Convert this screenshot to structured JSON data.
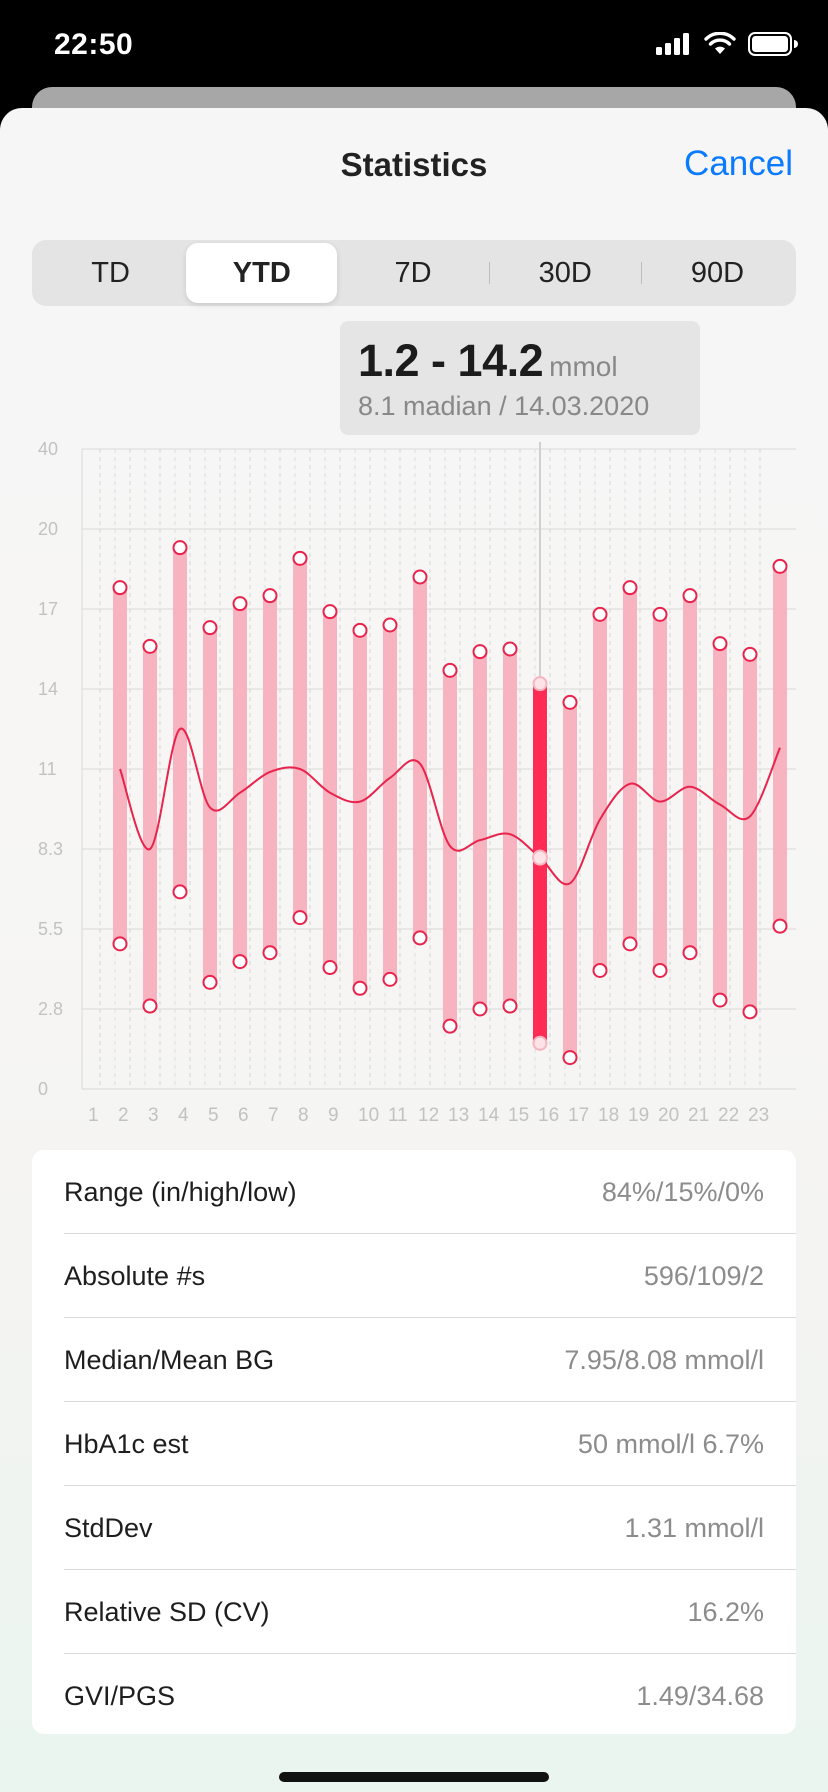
{
  "status": {
    "time": "22:50",
    "signal_icon": "signal-bars-icon",
    "wifi_icon": "wifi-icon",
    "battery_icon": "battery-icon"
  },
  "nav": {
    "title": "Statistics",
    "cancel_label": "Cancel"
  },
  "segments": [
    {
      "label": "TD",
      "selected": false
    },
    {
      "label": "YTD",
      "selected": true
    },
    {
      "label": "7D",
      "selected": false
    },
    {
      "label": "30D",
      "selected": false
    },
    {
      "label": "90D",
      "selected": false
    }
  ],
  "tooltip": {
    "range": "1.2 - 14.2",
    "unit": "mmol",
    "subtitle": "8.1 madian / 14.03.2020"
  },
  "chart_data": {
    "type": "bar",
    "subtype": "range-bar with median line",
    "y_tick_labels": [
      "40",
      "20",
      "17",
      "14",
      "11",
      "8.3",
      "5.5",
      "2.8",
      "0"
    ],
    "categories": [
      "1",
      "2",
      "3",
      "4",
      "5",
      "6",
      "7",
      "8",
      "9",
      "10",
      "11",
      "12",
      "13",
      "14",
      "15",
      "16",
      "17",
      "18",
      "19",
      "20",
      "21",
      "22",
      "23"
    ],
    "series": [
      {
        "low": [
          5.0,
          2.9,
          6.8,
          3.7,
          4.4,
          4.7,
          5.9,
          4.2,
          3.5,
          3.8,
          5.2,
          2.2,
          2.8,
          2.9,
          1.6,
          1.1,
          4.1,
          5.0,
          4.1,
          4.7,
          3.1,
          2.7,
          5.6
        ]
      },
      {
        "high": [
          17.8,
          15.6,
          19.3,
          16.3,
          17.2,
          17.5,
          18.9,
          16.9,
          16.2,
          16.4,
          18.2,
          14.7,
          15.4,
          15.5,
          14.2,
          13.5,
          16.8,
          17.8,
          16.8,
          17.5,
          15.7,
          15.3,
          18.6
        ]
      },
      {
        "median": [
          11.0,
          8.3,
          12.5,
          9.7,
          10.2,
          10.9,
          11.0,
          10.2,
          9.9,
          10.7,
          11.2,
          8.4,
          8.6,
          8.8,
          8.0,
          7.1,
          9.3,
          10.5,
          9.9,
          10.4,
          9.8,
          9.4,
          11.8
        ]
      }
    ],
    "selected_index": 14,
    "colors": {
      "bar": "#f8b3c0",
      "bar_selected": "#fe2b55",
      "marker": "#e8244c",
      "median_line": "#e8244c",
      "grid": "#d9d9d9"
    }
  },
  "stats": [
    {
      "label": "Range (in/high/low)",
      "value": "84%/15%/0%"
    },
    {
      "label": "Absolute #s",
      "value": "596/109/2"
    },
    {
      "label": "Median/Mean BG",
      "value": "7.95/8.08 mmol/l"
    },
    {
      "label": "HbA1c est",
      "value": "50 mmol/l 6.7%"
    },
    {
      "label": "StdDev",
      "value": "1.31 mmol/l"
    },
    {
      "label": "Relative SD (CV)",
      "value": "16.2%"
    },
    {
      "label": "GVI/PGS",
      "value": "1.49/34.68"
    }
  ]
}
